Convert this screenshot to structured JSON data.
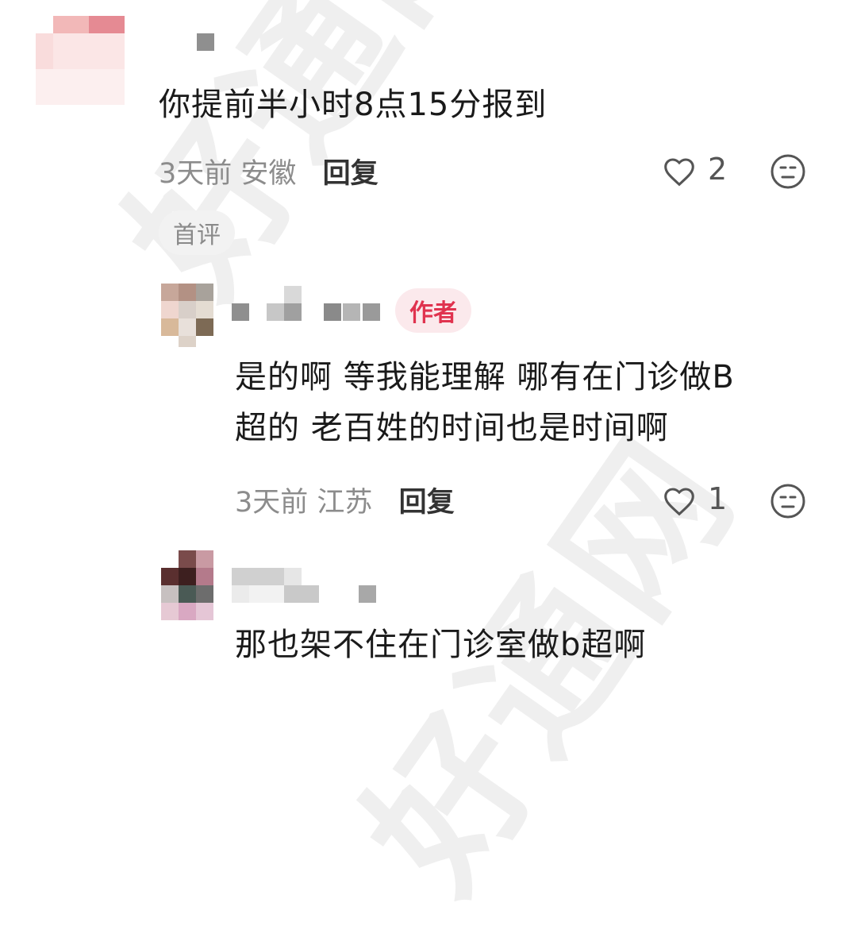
{
  "watermark": "好通网",
  "comments": [
    {
      "text": "你提前半小时8点15分报到",
      "time": "3天前",
      "location": "安徽",
      "reply_label": "回复",
      "likes": "2",
      "tag": "首评"
    },
    {
      "text_line1": "是的啊 等我能理解  哪有在门诊做B",
      "text_line2": "超的  老百姓的时间也是时间啊",
      "time": "3天前",
      "location": "江苏",
      "reply_label": "回复",
      "likes": "1",
      "tag": "作者"
    },
    {
      "text": "那也架不住在门诊室做b超啊"
    }
  ],
  "colors": {
    "author_tag": "#e0334f",
    "meta_gray": "#8c8c8c"
  },
  "icons": [
    "heart-outline-icon",
    "emoji-face-icon"
  ]
}
